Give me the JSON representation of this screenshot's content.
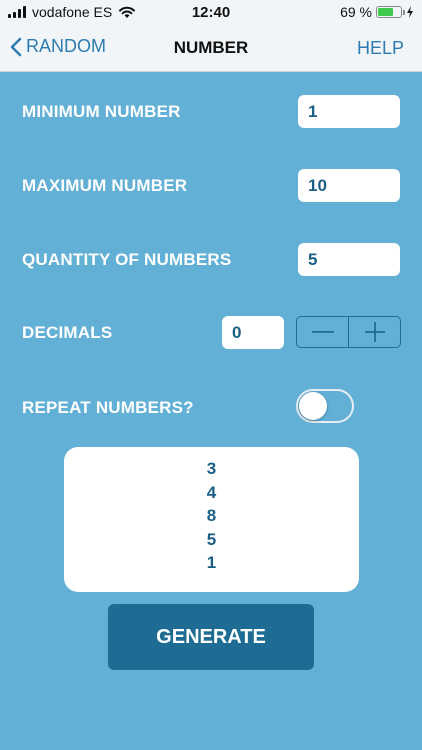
{
  "status_bar": {
    "carrier": "vodafone ES",
    "time": "12:40",
    "battery_percent": "69 %",
    "battery_level": 0.69
  },
  "nav": {
    "back_label": "RANDOM",
    "title": "NUMBER",
    "help_label": "HELP"
  },
  "form": {
    "minimum": {
      "label": "MINIMUM NUMBER",
      "value": "1"
    },
    "maximum": {
      "label": "MAXIMUM NUMBER",
      "value": "10"
    },
    "quantity": {
      "label": "QUANTITY OF NUMBERS",
      "value": "5"
    },
    "decimals": {
      "label": "DECIMALS",
      "value": "0"
    },
    "repeat": {
      "label": "REPEAT NUMBERS?",
      "on": false
    }
  },
  "results": [
    "3",
    "4",
    "8",
    "5",
    "1"
  ],
  "generate_label": "GENERATE",
  "colors": {
    "background": "#63b0d6",
    "accent": "#1e6c93",
    "link": "#2d7cb1",
    "battery": "#3dc94b"
  }
}
